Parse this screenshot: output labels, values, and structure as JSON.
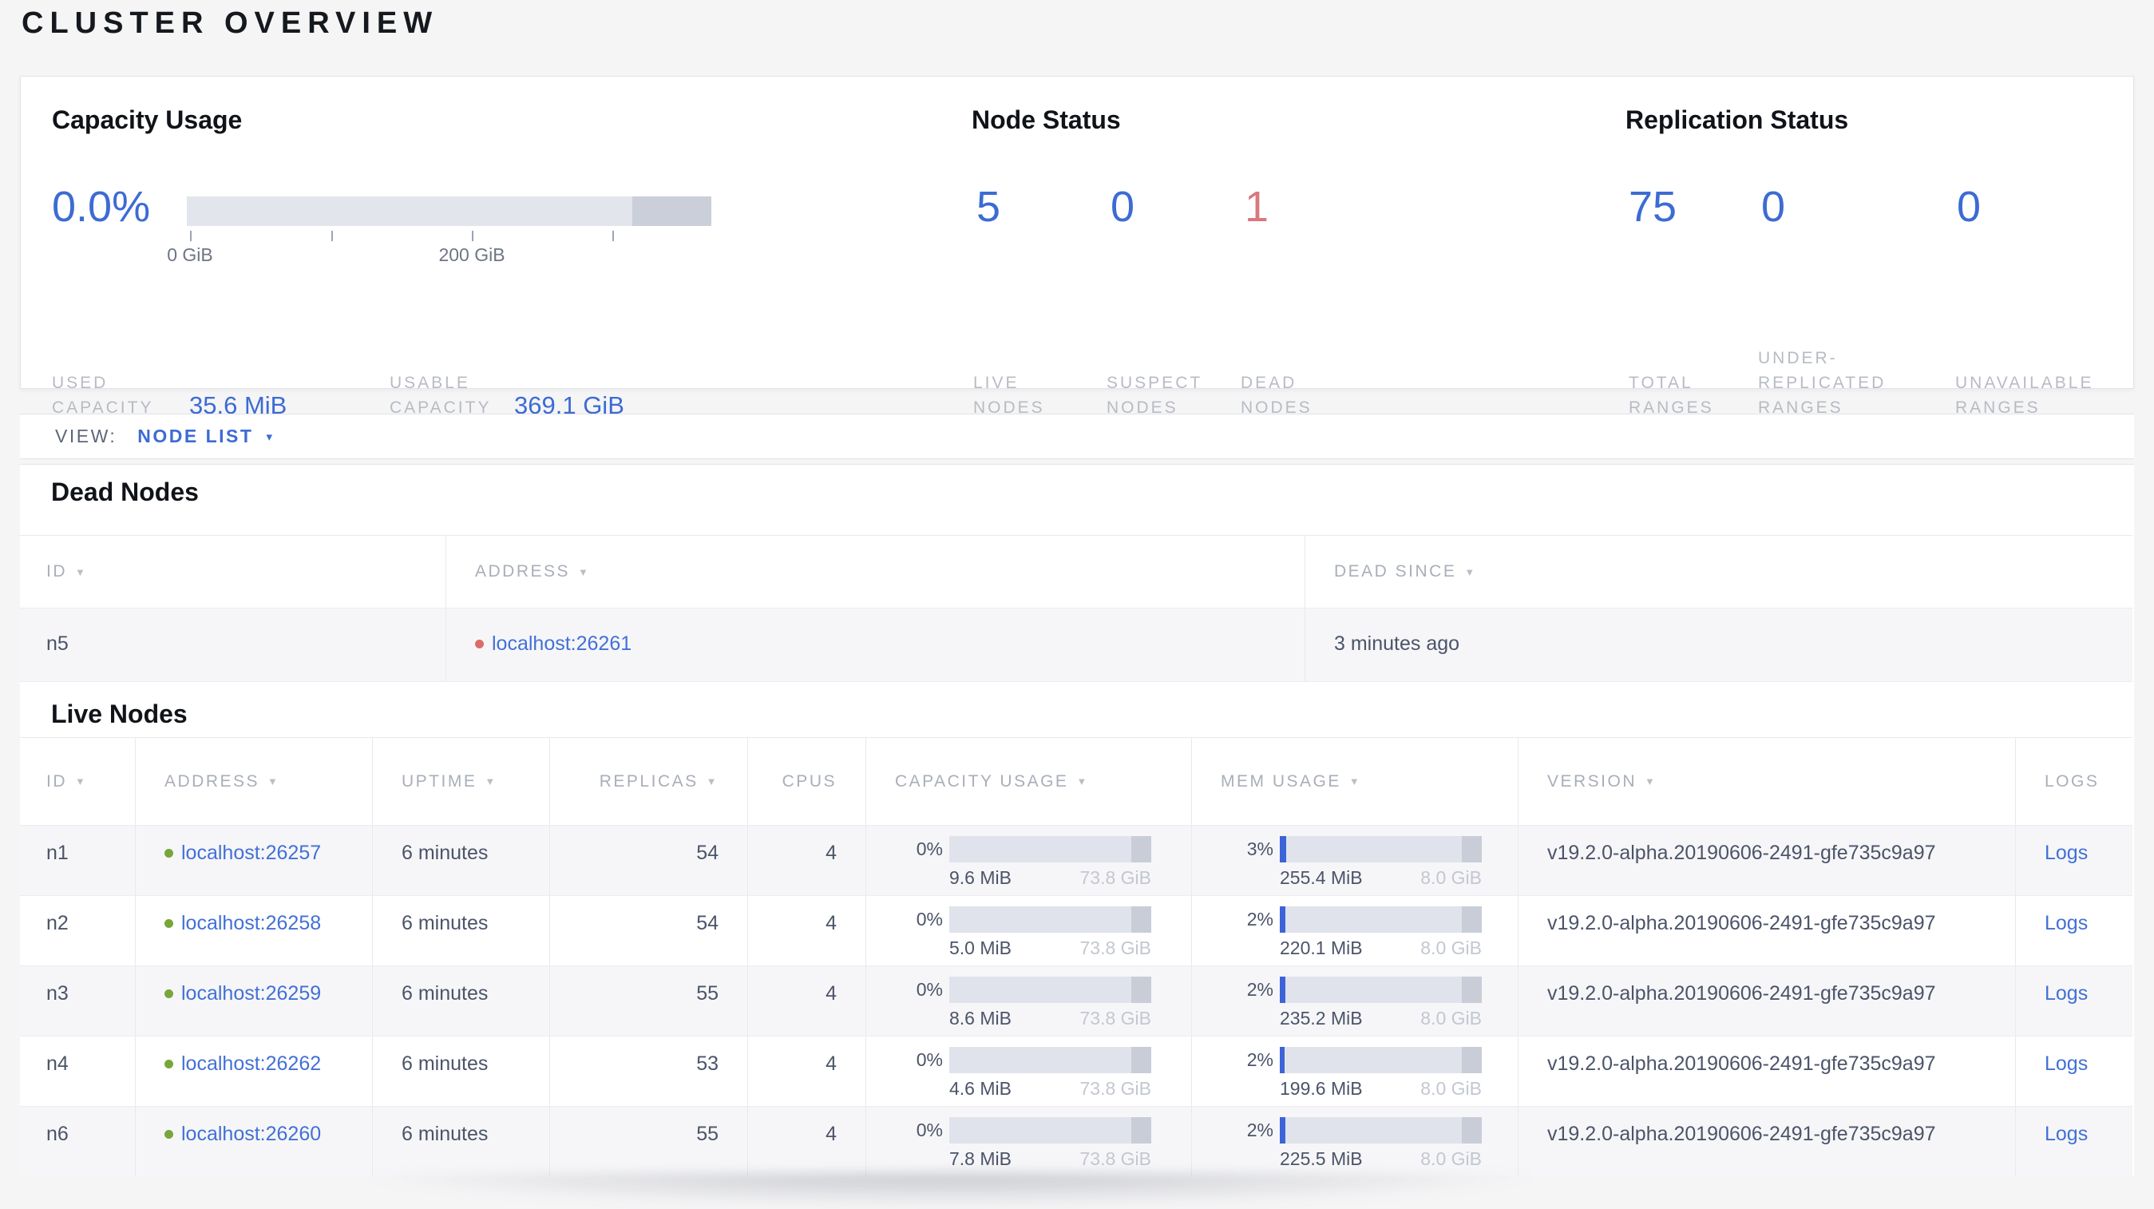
{
  "page": {
    "title": "CLUSTER OVERVIEW"
  },
  "colors": {
    "accent_blue": "#3d6bd3",
    "link_blue": "#4270d6",
    "dead_red": "#d9787f",
    "dot_red": "#dc6c6a",
    "dot_green": "#77a63a"
  },
  "summary": {
    "capacity": {
      "heading": "Capacity Usage",
      "percent": "0.0%",
      "axis_tick_0": "0 GiB",
      "axis_tick_200": "200 GiB",
      "used_label_line1": "USED",
      "used_label_line2": "CAPACITY",
      "used_value": "35.6 MiB",
      "usable_label_line1": "USABLE",
      "usable_label_line2": "CAPACITY",
      "usable_value": "369.1 GiB"
    },
    "node_status": {
      "heading": "Node Status",
      "stats": [
        {
          "value": "5",
          "label_line1": "LIVE",
          "label_line2": "NODES"
        },
        {
          "value": "0",
          "label_line1": "SUSPECT",
          "label_line2": "NODES"
        },
        {
          "value": "1",
          "label_line1": "DEAD",
          "label_line2": "NODES"
        }
      ]
    },
    "replication": {
      "heading": "Replication Status",
      "stats": [
        {
          "value": "75",
          "label_line1": "TOTAL",
          "label_line2": "RANGES"
        },
        {
          "value": "0",
          "label_line1": "UNDER-",
          "label_line2": "REPLICATED",
          "label_line3": "RANGES"
        },
        {
          "value": "0",
          "label_line1": "UNAVAILABLE",
          "label_line2": "RANGES"
        }
      ]
    }
  },
  "view_bar": {
    "label": "VIEW:",
    "selected": "NODE LIST",
    "caret": "▾"
  },
  "dead_nodes": {
    "heading": "Dead Nodes",
    "columns": [
      {
        "label": "ID"
      },
      {
        "label": "ADDRESS"
      },
      {
        "label": "DEAD SINCE"
      }
    ],
    "sort_arrow": "▼",
    "rows": [
      {
        "id": "n5",
        "address": "localhost:26261",
        "dead_since": "3 minutes ago"
      }
    ]
  },
  "live_nodes": {
    "heading": "Live Nodes",
    "columns": [
      {
        "label": "ID"
      },
      {
        "label": "ADDRESS"
      },
      {
        "label": "UPTIME"
      },
      {
        "label": "REPLICAS"
      },
      {
        "label": "CPUS"
      },
      {
        "label": "CAPACITY USAGE"
      },
      {
        "label": "MEM USAGE"
      },
      {
        "label": "VERSION"
      },
      {
        "label": "LOGS"
      }
    ],
    "sort_arrow": "▼",
    "rows": [
      {
        "id": "n1",
        "address": "localhost:26257",
        "uptime": "6 minutes",
        "replicas": "54",
        "cpus": "4",
        "cap_pct": "0%",
        "cap_fill": 0,
        "cap_used": "9.6 MiB",
        "cap_total": "73.8 GiB",
        "mem_pct": "3%",
        "mem_fill": 3,
        "mem_used": "255.4 MiB",
        "mem_total": "8.0 GiB",
        "version": "v19.2.0-alpha.20190606-2491-gfe735c9a97",
        "logs_label": "Logs"
      },
      {
        "id": "n2",
        "address": "localhost:26258",
        "uptime": "6 minutes",
        "replicas": "54",
        "cpus": "4",
        "cap_pct": "0%",
        "cap_fill": 0,
        "cap_used": "5.0 MiB",
        "cap_total": "73.8 GiB",
        "mem_pct": "2%",
        "mem_fill": 2.6,
        "mem_used": "220.1 MiB",
        "mem_total": "8.0 GiB",
        "version": "v19.2.0-alpha.20190606-2491-gfe735c9a97",
        "logs_label": "Logs"
      },
      {
        "id": "n3",
        "address": "localhost:26259",
        "uptime": "6 minutes",
        "replicas": "55",
        "cpus": "4",
        "cap_pct": "0%",
        "cap_fill": 0,
        "cap_used": "8.6 MiB",
        "cap_total": "73.8 GiB",
        "mem_pct": "2%",
        "mem_fill": 2.8,
        "mem_used": "235.2 MiB",
        "mem_total": "8.0 GiB",
        "version": "v19.2.0-alpha.20190606-2491-gfe735c9a97",
        "logs_label": "Logs"
      },
      {
        "id": "n4",
        "address": "localhost:26262",
        "uptime": "6 minutes",
        "replicas": "53",
        "cpus": "4",
        "cap_pct": "0%",
        "cap_fill": 0,
        "cap_used": "4.6 MiB",
        "cap_total": "73.8 GiB",
        "mem_pct": "2%",
        "mem_fill": 2.4,
        "mem_used": "199.6 MiB",
        "mem_total": "8.0 GiB",
        "version": "v19.2.0-alpha.20190606-2491-gfe735c9a97",
        "logs_label": "Logs"
      },
      {
        "id": "n6",
        "address": "localhost:26260",
        "uptime": "6 minutes",
        "replicas": "55",
        "cpus": "4",
        "cap_pct": "0%",
        "cap_fill": 0,
        "cap_used": "7.8 MiB",
        "cap_total": "73.8 GiB",
        "mem_pct": "2%",
        "mem_fill": 2.7,
        "mem_used": "225.5 MiB",
        "mem_total": "8.0 GiB",
        "version": "v19.2.0-alpha.20190606-2491-gfe735c9a97",
        "logs_label": "Logs"
      }
    ]
  }
}
